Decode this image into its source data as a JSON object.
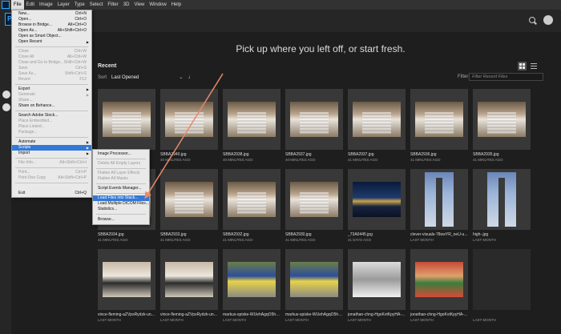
{
  "menubar": {
    "items": [
      "File",
      "Edit",
      "Image",
      "Layer",
      "Type",
      "Select",
      "Filter",
      "3D",
      "View",
      "Window",
      "Help"
    ]
  },
  "appbar": {
    "logo_text": "Ps"
  },
  "home": {
    "headline": "Pick up where you left off, or start fresh.",
    "recent_title": "Recent",
    "sort_label": "Sort",
    "sort_value": "Last Opened",
    "filter_label": "Filter",
    "filter_placeholder": "Filter Recent Files"
  },
  "files": [
    {
      "name": "",
      "date": ""
    },
    {
      "name": "SBBA2940.jpg",
      "date": "40 MINUTES AGO"
    },
    {
      "name": "SBBA2938.jpg",
      "date": "40 MINUTES AGO"
    },
    {
      "name": "SBBA2937.jpg",
      "date": "40 MINUTES AGO"
    },
    {
      "name": "SBBA2937.jpg",
      "date": "41 MINUTES AGO"
    },
    {
      "name": "SBBA2936.jpg",
      "date": "41 MINUTES AGO"
    },
    {
      "name": "SBBA2935.jpg",
      "date": "41 MINUTES AGO"
    },
    {
      "name": "SBBA2934.jpg",
      "date": "41 MINUTES AGO"
    },
    {
      "name": "SBBA2933.jpg",
      "date": "41 MINUTES AGO"
    },
    {
      "name": "SBBA2932.jpg",
      "date": "41 MINUTES AGO"
    },
    {
      "name": "SBBA2930.jpg",
      "date": "41 MINUTES AGO"
    },
    {
      "name": "_73A0445.jpg",
      "date": "21 DAYS AGO"
    },
    {
      "name": "clever-visuals-78owYR_neU-u...",
      "date": "LAST MONTH"
    },
    {
      "name": "high-.jpg",
      "date": "LAST MONTH"
    },
    {
      "name": "vince-fleming-aZVpsRydzk-un...",
      "date": "LAST MONTH"
    },
    {
      "name": "vince-fleming-aZVpsRydzk-un...",
      "date": "LAST MONTH"
    },
    {
      "name": "markus-spiske-WUehAgqO5hE...",
      "date": "LAST MONTH"
    },
    {
      "name": "markus-spiske-WUehAgqO5hE...",
      "date": "LAST MONTH"
    },
    {
      "name": "jonathan-chng-HgoKvtKpyHA-...",
      "date": "LAST MONTH"
    },
    {
      "name": "jonathan-chng-HgoKvtKpyHA-...",
      "date": "LAST MONTH"
    },
    {
      "name": "",
      "date": "LAST MONTH"
    }
  ],
  "file_menu": [
    {
      "label": "New...",
      "shortcut": "Ctrl+N"
    },
    {
      "label": "Open...",
      "shortcut": "Ctrl+O"
    },
    {
      "label": "Browse in Bridge...",
      "shortcut": "Alt+Ctrl+O"
    },
    {
      "label": "Open As...",
      "shortcut": "Alt+Shift+Ctrl+O"
    },
    {
      "label": "Open as Smart Object...",
      "shortcut": ""
    },
    {
      "label": "Open Recent",
      "shortcut": ""
    },
    {
      "label": "Close",
      "shortcut": "Ctrl+W"
    },
    {
      "label": "Close All",
      "shortcut": "Alt+Ctrl+W"
    },
    {
      "label": "Close and Go to Bridge...",
      "shortcut": "Shift+Ctrl+W"
    },
    {
      "label": "Save",
      "shortcut": "Ctrl+S"
    },
    {
      "label": "Save As...",
      "shortcut": "Shift+Ctrl+S"
    },
    {
      "label": "Revert",
      "shortcut": "F12"
    },
    {
      "label": "Export",
      "shortcut": ""
    },
    {
      "label": "Generate",
      "shortcut": ""
    },
    {
      "label": "Share...",
      "shortcut": ""
    },
    {
      "label": "Share on Behance...",
      "shortcut": ""
    },
    {
      "label": "Search Adobe Stock...",
      "shortcut": ""
    },
    {
      "label": "Place Embedded...",
      "shortcut": ""
    },
    {
      "label": "Place Linked...",
      "shortcut": ""
    },
    {
      "label": "Package...",
      "shortcut": ""
    },
    {
      "label": "Automate",
      "shortcut": ""
    },
    {
      "label": "Scripts",
      "shortcut": ""
    },
    {
      "label": "Import",
      "shortcut": ""
    },
    {
      "label": "File Info...",
      "shortcut": "Alt+Shift+Ctrl+I"
    },
    {
      "label": "Print...",
      "shortcut": "Ctrl+P"
    },
    {
      "label": "Print One Copy",
      "shortcut": "Alt+Shift+Ctrl+P"
    },
    {
      "label": "Exit",
      "shortcut": "Ctrl+Q"
    }
  ],
  "scripts_menu": [
    "Image Processor...",
    "Delete All Empty Layers",
    "Flatten All Layer Effects",
    "Flatten All Masks",
    "Script Events Manager...",
    "Load Files into Stack...",
    "Load Multiple DICOM Files...",
    "Statistics...",
    "Browse..."
  ],
  "colors": {
    "accent": "#3378d6",
    "annotation_arrow": "#e8896a"
  }
}
